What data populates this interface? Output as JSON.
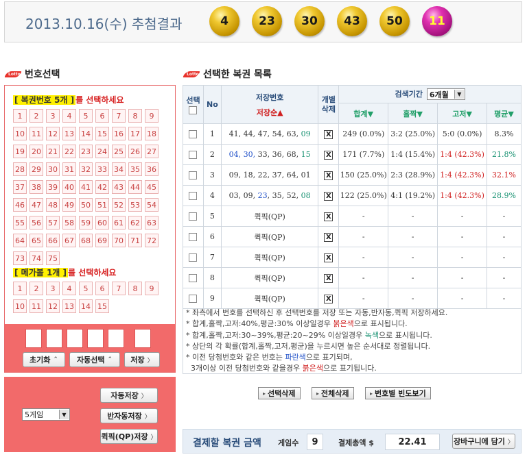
{
  "header": {
    "draw_title": "2013.10.16(수) 추첨결과",
    "balls": [
      "4",
      "23",
      "30",
      "43",
      "50"
    ],
    "bonus": "11"
  },
  "left": {
    "title": "번호선택",
    "pick_main_hl": "[ 복권번호 5개 ]",
    "pick_main_rest": "를 선택하세요",
    "main_numbers": [
      "1",
      "2",
      "3",
      "4",
      "5",
      "6",
      "7",
      "8",
      "9",
      "10",
      "11",
      "12",
      "13",
      "14",
      "15",
      "16",
      "17",
      "18",
      "19",
      "20",
      "21",
      "22",
      "23",
      "24",
      "25",
      "26",
      "27",
      "28",
      "29",
      "30",
      "31",
      "32",
      "33",
      "34",
      "35",
      "36",
      "37",
      "38",
      "39",
      "40",
      "41",
      "42",
      "43",
      "44",
      "45",
      "46",
      "47",
      "48",
      "49",
      "50",
      "51",
      "52",
      "53",
      "54",
      "55",
      "56",
      "57",
      "58",
      "59",
      "60",
      "61",
      "62",
      "63",
      "64",
      "65",
      "66",
      "67",
      "68",
      "69",
      "70",
      "71",
      "72",
      "73",
      "74",
      "75"
    ],
    "pick_mega_hl": "[ 메가볼 1개 ]",
    "pick_mega_rest": "를 선택하세요",
    "mega_numbers": [
      "1",
      "2",
      "3",
      "4",
      "5",
      "6",
      "7",
      "8",
      "9",
      "10",
      "11",
      "12",
      "13",
      "14",
      "15"
    ],
    "reset_label": "초기화",
    "auto_select_label": "자동선택",
    "save_label": "저장",
    "game_count_select": "5게임",
    "auto_save_label": "자동저장",
    "semi_auto_save_label": "반자동저장",
    "quick_pick_save_label": "퀵픽(QP)저장",
    "lotto_icon_text": "Lotto"
  },
  "right": {
    "title": "선택한 복권 목록",
    "col_select": "선택",
    "col_no": "No",
    "col_saved_numbers": "저장번호",
    "col_saved_sort": "저장순▲",
    "col_delete": "개별\n삭제",
    "col_period_label": "검색기간",
    "period_select": "6개월",
    "sub_sum": "합계▼",
    "sub_oddeven": "홀짝▼",
    "sub_highlow": "고저▼",
    "sub_avg": "평균▼",
    "rows": [
      {
        "no": "1",
        "n1": "41, 44, 47, 54, 63, ",
        "n2": "09",
        "sum": "249 (0.0%)",
        "oe": "3:2 (25.0%)",
        "hl": "5:0 (0.0%)",
        "avg": "8.3%"
      },
      {
        "no": "2",
        "n1": "04, 30, ",
        "n2": "33, 36, 68, ",
        "n3": "15",
        "sum": "171 (7.7%)",
        "oe": "1:4 (15.4%)",
        "hl": "1:4 (42.3%)",
        "avg": "21.8%"
      },
      {
        "no": "3",
        "n1": "09, 18, 22, 37, 64, 01",
        "sum": "150 (25.0%)",
        "oe": "2:3 (28.9%)",
        "hl": "1:4 (42.3%)",
        "avg": "32.1%"
      },
      {
        "no": "4",
        "n1": "03, 09, ",
        "n2": "23",
        "n3": ", 35, 52, ",
        "n4": "08",
        "sum": "122 (25.0%)",
        "oe": "4:1 (19.2%)",
        "hl": "1:4 (42.3%)",
        "avg": "28.9%"
      },
      {
        "no": "5",
        "qp": "퀵픽(QP)"
      },
      {
        "no": "6",
        "qp": "퀵픽(QP)"
      },
      {
        "no": "7",
        "qp": "퀵픽(QP)"
      },
      {
        "no": "8",
        "qp": "퀵픽(QP)"
      },
      {
        "no": "9",
        "qp": "퀵픽(QP)"
      }
    ],
    "dash": "-",
    "delete_mark": "X",
    "notes": {
      "l1": "* 좌측에서 번호를 선택하신 후 선택번호를 저장 또는 자동,반자동,퀵픽 저장하세요.",
      "l2a": "* 합계,홀짝,고저:40%,평균:30% 이상일경우 ",
      "l2b": "붉은색",
      "l2c": "으로 표시됩니다.",
      "l3a": "* 합계,홀짝,고저:30~39%,평균:20~29% 이상일경우 ",
      "l3b": "녹색",
      "l3c": "으로 표시됩니다.",
      "l4": "* 상단의 각 확률(합계,홀짝,고저,평균)을 누르시면 높은 순서대로 정렬됩니다.",
      "l5a": "* 이전 당첨번호와 같은 번호는 ",
      "l5b": "파란색",
      "l5c": "으로 표기되며,",
      "l6a": "  3개이상 이전 당첨번호와 같을경우 ",
      "l6b": "붉은색",
      "l6c": "으로 표기됩니다."
    },
    "delete_selected_label": "선택삭제",
    "delete_all_label": "전체삭제",
    "frequency_label": "번호별 빈도보기",
    "pay_title": "결제할 복권 금액",
    "game_count_label": "게임수",
    "game_count_value": "9",
    "total_label": "결제총액 $",
    "total_value": "22.41",
    "cart_label": "장바구니에 담기"
  },
  "colors": {
    "accent_red": "#f26a6a",
    "gold_ball": "#e0b000",
    "bonus_ball": "#d0209a",
    "header_blue": "#4d6a8c"
  }
}
